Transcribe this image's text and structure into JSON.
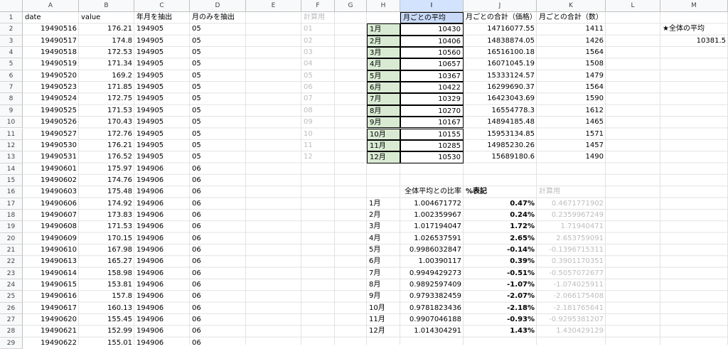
{
  "columns": [
    "A",
    "B",
    "C",
    "D",
    "E",
    "F",
    "G",
    "H",
    "I",
    "J",
    "K",
    "L",
    "M"
  ],
  "selected_column": "I",
  "rows": [
    "1",
    "2",
    "3",
    "4",
    "5",
    "6",
    "7",
    "8",
    "9",
    "10",
    "11",
    "12",
    "13",
    "14",
    "15",
    "16",
    "17",
    "18",
    "19",
    "20",
    "21",
    "22",
    "23",
    "24",
    "25",
    "26",
    "27",
    "28",
    "29"
  ],
  "headers": {
    "A": "date",
    "B": "value",
    "C": "年月を抽出",
    "D": "月のみを抽出",
    "F": "計算用",
    "I": "月ごとの平均",
    "J": "月ごとの合計（価格）",
    "K": "月ごとの合計（数）"
  },
  "data_rows": [
    [
      "19490516",
      "176.21",
      "194905",
      "05"
    ],
    [
      "19490517",
      "174.8",
      "194905",
      "05"
    ],
    [
      "19490518",
      "172.53",
      "194905",
      "05"
    ],
    [
      "19490519",
      "171.34",
      "194905",
      "05"
    ],
    [
      "19490520",
      "169.2",
      "194905",
      "05"
    ],
    [
      "19490523",
      "171.85",
      "194905",
      "05"
    ],
    [
      "19490524",
      "172.75",
      "194905",
      "05"
    ],
    [
      "19490525",
      "171.53",
      "194905",
      "05"
    ],
    [
      "19490526",
      "170.43",
      "194905",
      "05"
    ],
    [
      "19490527",
      "172.76",
      "194905",
      "05"
    ],
    [
      "19490530",
      "176.21",
      "194905",
      "05"
    ],
    [
      "19490531",
      "176.52",
      "194905",
      "05"
    ],
    [
      "19490601",
      "175.97",
      "194906",
      "06"
    ],
    [
      "19490602",
      "174.76",
      "194906",
      "06"
    ],
    [
      "19490603",
      "175.48",
      "194906",
      "06"
    ],
    [
      "19490606",
      "174.92",
      "194906",
      "06"
    ],
    [
      "19490607",
      "173.83",
      "194906",
      "06"
    ],
    [
      "19490608",
      "171.53",
      "194906",
      "06"
    ],
    [
      "19490609",
      "170.15",
      "194906",
      "06"
    ],
    [
      "19490610",
      "167.98",
      "194906",
      "06"
    ],
    [
      "19490613",
      "165.27",
      "194906",
      "06"
    ],
    [
      "19490614",
      "158.98",
      "194906",
      "06"
    ],
    [
      "19490615",
      "153.81",
      "194906",
      "06"
    ],
    [
      "19490616",
      "157.8",
      "194906",
      "06"
    ],
    [
      "19490617",
      "160.13",
      "194906",
      "06"
    ],
    [
      "19490620",
      "155.45",
      "194906",
      "06"
    ],
    [
      "19490621",
      "152.99",
      "194906",
      "06"
    ],
    [
      "19490622",
      "155.01",
      "194906",
      "06"
    ]
  ],
  "calc_f": [
    "01",
    "02",
    "03",
    "04",
    "05",
    "06",
    "07",
    "08",
    "09",
    "10",
    "11",
    "12"
  ],
  "monthly": [
    [
      "1月",
      "10430",
      "14716077.55",
      "1411"
    ],
    [
      "2月",
      "10406",
      "14838874.05",
      "1426"
    ],
    [
      "3月",
      "10560",
      "16516100.18",
      "1564"
    ],
    [
      "4月",
      "10657",
      "16071045.19",
      "1508"
    ],
    [
      "5月",
      "10367",
      "15333124.57",
      "1479"
    ],
    [
      "6月",
      "10422",
      "16299690.37",
      "1564"
    ],
    [
      "7月",
      "10329",
      "16423043.69",
      "1590"
    ],
    [
      "8月",
      "10270",
      "16554778.3",
      "1612"
    ],
    [
      "9月",
      "10167",
      "14894185.48",
      "1465"
    ],
    [
      "10月",
      "10155",
      "15953134.85",
      "1571"
    ],
    [
      "11月",
      "10285",
      "14985230.26",
      "1457"
    ],
    [
      "12月",
      "10530",
      "15689180.6",
      "1490"
    ]
  ],
  "overall": {
    "label": "★全体の平均",
    "value": "10381.5"
  },
  "ratio_headers": {
    "ratio": "全体平均との比率",
    "pct": "%表記",
    "calc": "計算用"
  },
  "ratios": [
    [
      "1月",
      "1.004671772",
      "0.47%",
      "0.4671771902"
    ],
    [
      "2月",
      "1.002359967",
      "0.24%",
      "0.2359967249"
    ],
    [
      "3月",
      "1.017194047",
      "1.72%",
      "1.71940471"
    ],
    [
      "4月",
      "1.026537591",
      "2.65%",
      "2.653759091"
    ],
    [
      "5月",
      "0.9986032847",
      "-0.14%",
      "-0.1396715311"
    ],
    [
      "6月",
      "1.00390117",
      "0.39%",
      "0.3901170351"
    ],
    [
      "7月",
      "0.9949429273",
      "-0.51%",
      "-0.5057072677"
    ],
    [
      "8月",
      "0.9892597409",
      "-1.07%",
      "-1.074025911"
    ],
    [
      "9月",
      "0.9793382459",
      "-2.07%",
      "-2.066175408"
    ],
    [
      "10月",
      "0.9781823436",
      "-2.18%",
      "-2.181765641"
    ],
    [
      "11月",
      "0.9907046188",
      "-0.93%",
      "-0.9295381207"
    ],
    [
      "12月",
      "1.014304291",
      "1.43%",
      "1.430429129"
    ]
  ]
}
